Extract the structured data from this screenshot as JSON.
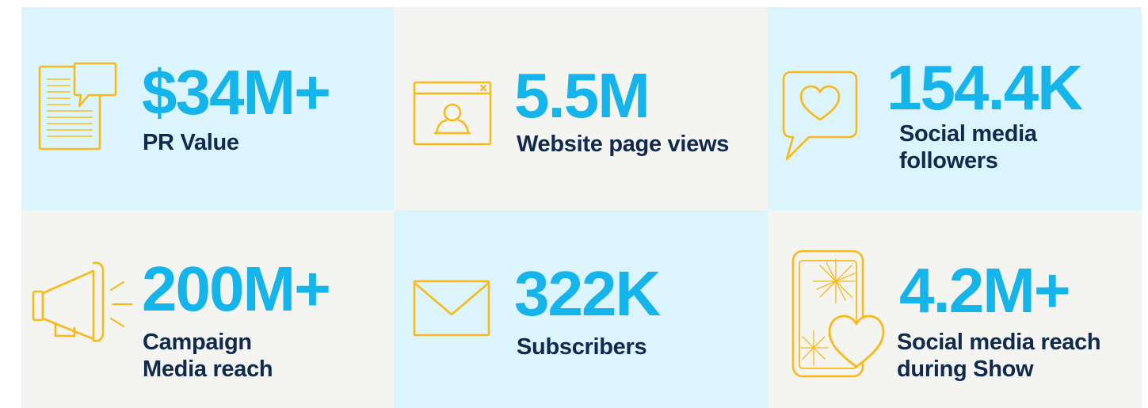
{
  "colors": {
    "accent_number": "#15b4ea",
    "label_text": "#0f2a4d",
    "icon_stroke": "#f8b91b",
    "tile_blue": "#dcf4fb",
    "tile_cream": "#f4f4f0"
  },
  "stats": [
    {
      "icon": "press-release-icon",
      "value": "$34M+",
      "label_lines": [
        "PR Value"
      ]
    },
    {
      "icon": "browser-profile-icon",
      "value": "5.5M",
      "label_lines": [
        "Website page views"
      ]
    },
    {
      "icon": "heart-speech-bubble-icon",
      "value": "154.4K",
      "label_lines": [
        "Social media",
        "followers"
      ]
    },
    {
      "icon": "megaphone-icon",
      "value": "200M+",
      "label_lines": [
        "Campaign",
        "Media reach"
      ]
    },
    {
      "icon": "envelope-icon",
      "value": "322K",
      "label_lines": [
        "Subscribers"
      ]
    },
    {
      "icon": "phone-heart-icon",
      "value": "4.2M+",
      "label_lines": [
        "Social media reach",
        "during Show"
      ]
    }
  ]
}
